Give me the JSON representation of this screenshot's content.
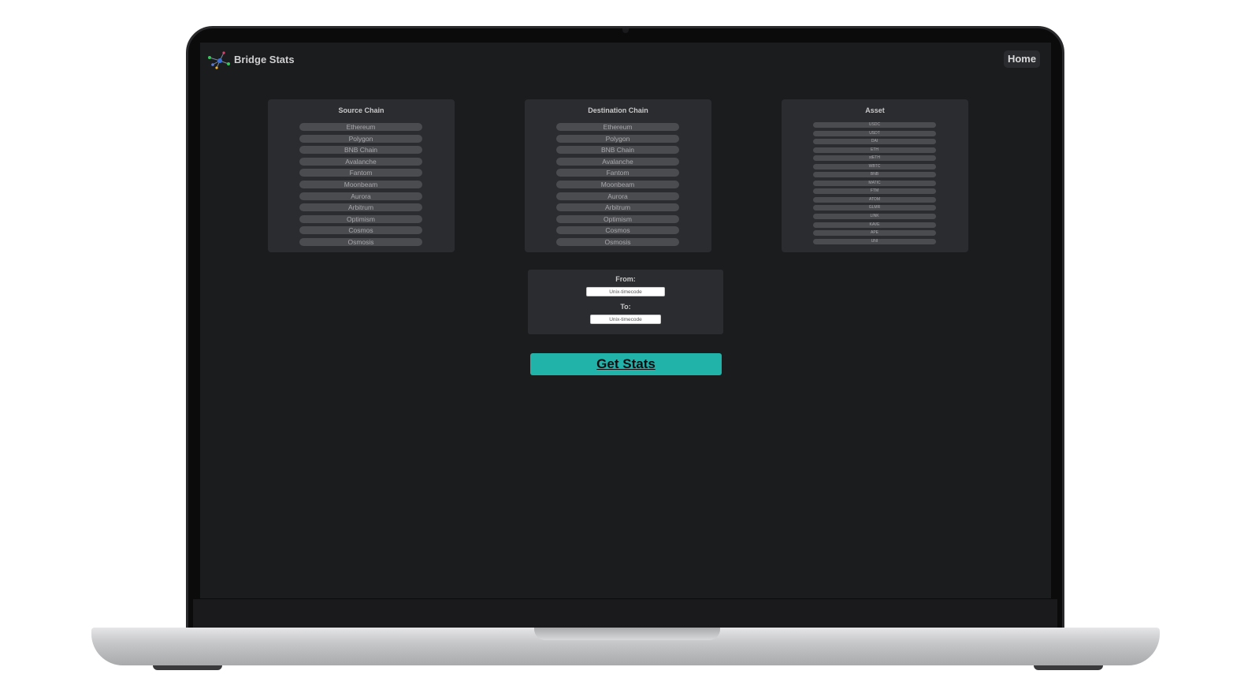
{
  "header": {
    "brand": "Bridge Stats",
    "home_label": "Home"
  },
  "source": {
    "title": "Source Chain",
    "items": [
      "Ethereum",
      "Polygon",
      "BNB Chain",
      "Avalanche",
      "Fantom",
      "Moonbeam",
      "Aurora",
      "Arbitrum",
      "Optimism",
      "Cosmos",
      "Osmosis"
    ]
  },
  "destination": {
    "title": "Destination Chain",
    "items": [
      "Ethereum",
      "Polygon",
      "BNB Chain",
      "Avalanche",
      "Fantom",
      "Moonbeam",
      "Aurora",
      "Arbitrum",
      "Optimism",
      "Cosmos",
      "Osmosis"
    ]
  },
  "asset": {
    "title": "Asset",
    "items": [
      "USDC",
      "USDT",
      "DAI",
      "ETH",
      "stETH",
      "WBTC",
      "BNB",
      "MATIC",
      "FTM",
      "ATOM",
      "GLMR",
      "LINK",
      "KAVE",
      "APE",
      "UNI"
    ]
  },
  "time": {
    "from_label": "From:",
    "from_placeholder": "Unix-timecode",
    "to_label": "To:",
    "to_placeholder": "Unix-timecode"
  },
  "actions": {
    "get_stats_label": "Get Stats"
  },
  "colors": {
    "accent": "#21b3aa",
    "background": "#1b1c1e",
    "panel": "#2b2c2f"
  }
}
